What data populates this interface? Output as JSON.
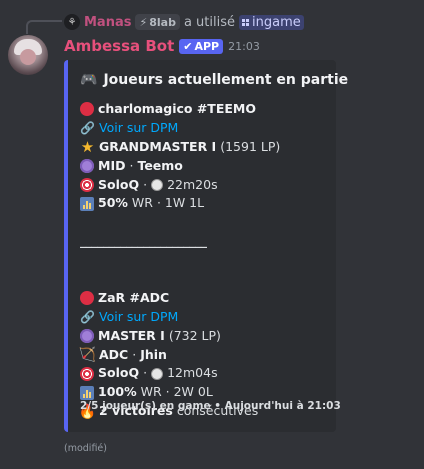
{
  "reply": {
    "user": "Manas",
    "server_tag": "8lab",
    "action": "a utilisé",
    "command": "ingame"
  },
  "message": {
    "author": "Ambessa Bot",
    "app_tag": "APP",
    "time": "21:03",
    "edited": "(modifié)"
  },
  "embed": {
    "title": "Joueurs actuellement en partie",
    "accent_color": "#5865f2",
    "players": [
      {
        "name": "charlomagico #TEEMO",
        "link": "Voir sur DPM",
        "rank": "GRANDMASTER I",
        "lp": "(1591 LP)",
        "role": "MID",
        "champion": "Teemo",
        "queue": "SoloQ",
        "duration": "22m20s",
        "winrate": "50%",
        "wr_label": "WR · 1W 1L"
      },
      {
        "name": "ZaR #ADC",
        "link": "Voir sur DPM",
        "rank": "MASTER I",
        "lp": "(732 LP)",
        "role": "ADC",
        "champion": "Jhin",
        "queue": "SoloQ",
        "duration": "12m04s",
        "winrate": "100%",
        "wr_label": "WR · 2W 0L",
        "streak": "2 victoires",
        "streak_label": "consécutives"
      }
    ],
    "divider": "______________________",
    "footer": "2/5 joueur(s) en game • Aujourd'hui à 21:03"
  },
  "separator_dot": "·"
}
